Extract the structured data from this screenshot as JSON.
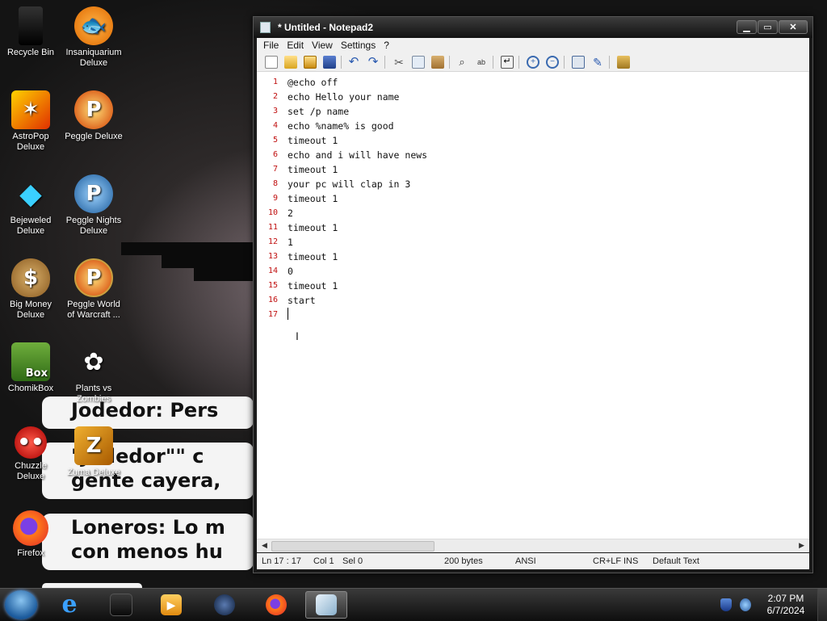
{
  "desktop": {
    "icons": [
      {
        "label": "Recycle Bin",
        "icon": "recycle-bin-icon"
      },
      {
        "label": "Insaniquarium Deluxe",
        "icon": "fish-icon"
      },
      {
        "label": "AstroPop Deluxe",
        "icon": "astropop-icon"
      },
      {
        "label": "Peggle Deluxe",
        "icon": "peggle-icon"
      },
      {
        "label": "Bejeweled Deluxe",
        "icon": "gem-icon"
      },
      {
        "label": "Peggle Nights Deluxe",
        "icon": "peggle-nights-icon"
      },
      {
        "label": "Big Money Deluxe",
        "icon": "money-bag-icon"
      },
      {
        "label": "Peggle World of Warcraft ...",
        "icon": "peggle-wow-icon"
      },
      {
        "label": "ChomikBox",
        "icon": "chomikbox-icon"
      },
      {
        "label": "Plants vs Zombies",
        "icon": "plants-icon"
      },
      {
        "label": "Chuzzle Deluxe",
        "icon": "chuzzle-icon"
      },
      {
        "label": "Zuma Deluxe",
        "icon": "zuma-icon"
      },
      {
        "label": "Firefox",
        "icon": "firefox-icon"
      }
    ],
    "wallpaper_text": {
      "line1": "Jodedor: Pers",
      "line2": "\"Jodedor\"\" c",
      "line3": "gente cayera,",
      "line4": "Loneros: Lo m",
      "line5": "con menos hu"
    }
  },
  "window": {
    "title": "* Untitled - Notepad2",
    "controls": {
      "minimize": "▁",
      "maximize": "▭",
      "close": "✕"
    },
    "menu": [
      "File",
      "Edit",
      "View",
      "Settings",
      "?"
    ],
    "toolbar_icons": [
      "new-icon",
      "open-icon",
      "browse-icon",
      "save-icon",
      "undo-icon",
      "redo-icon",
      "cut-icon",
      "copy-icon",
      "paste-icon",
      "find-icon",
      "replace-icon",
      "word-wrap-icon",
      "zoom-in-icon",
      "zoom-out-icon",
      "scheme-icon",
      "customize-icon",
      "exit-icon"
    ],
    "lines": [
      {
        "n": "1",
        "text": "@echo off"
      },
      {
        "n": "2",
        "text": "echo Hello your name"
      },
      {
        "n": "3",
        "text": "set /p name"
      },
      {
        "n": "4",
        "text": "echo %name% is good"
      },
      {
        "n": "5",
        "text": "timeout 1"
      },
      {
        "n": "6",
        "text": "echo and i will have news"
      },
      {
        "n": "7",
        "text": "timeout 1"
      },
      {
        "n": "8",
        "text": "your pc will clap in 3"
      },
      {
        "n": "9",
        "text": "timeout 1"
      },
      {
        "n": "10",
        "text": "2"
      },
      {
        "n": "11",
        "text": "timeout 1"
      },
      {
        "n": "12",
        "text": "1"
      },
      {
        "n": "13",
        "text": "timeout 1"
      },
      {
        "n": "14",
        "text": "0"
      },
      {
        "n": "15",
        "text": "timeout 1"
      },
      {
        "n": "16",
        "text": "start"
      },
      {
        "n": "17",
        "text": ""
      }
    ],
    "status": {
      "position": "Ln 17 : 17",
      "column": "Col 1",
      "selection": "Sel 0",
      "size": "200 bytes",
      "encoding": "ANSI",
      "line_ending": "CR+LF",
      "mode": "INS",
      "scheme": "Default Text"
    }
  },
  "taskbar": {
    "apps": [
      "start-orb-icon",
      "internet-explorer-icon",
      "window-icon",
      "media-player-icon",
      "globe-icon",
      "firefox-icon",
      "notepad2-icon"
    ],
    "clock": {
      "time": "2:07 PM",
      "date": "6/7/2024"
    },
    "tray_icons": [
      "shield-icon",
      "network-icon"
    ]
  },
  "colors": {
    "line_number": "#c01010",
    "titlebar": "#1a1a1a",
    "taskbar": "#1f1f1f"
  }
}
